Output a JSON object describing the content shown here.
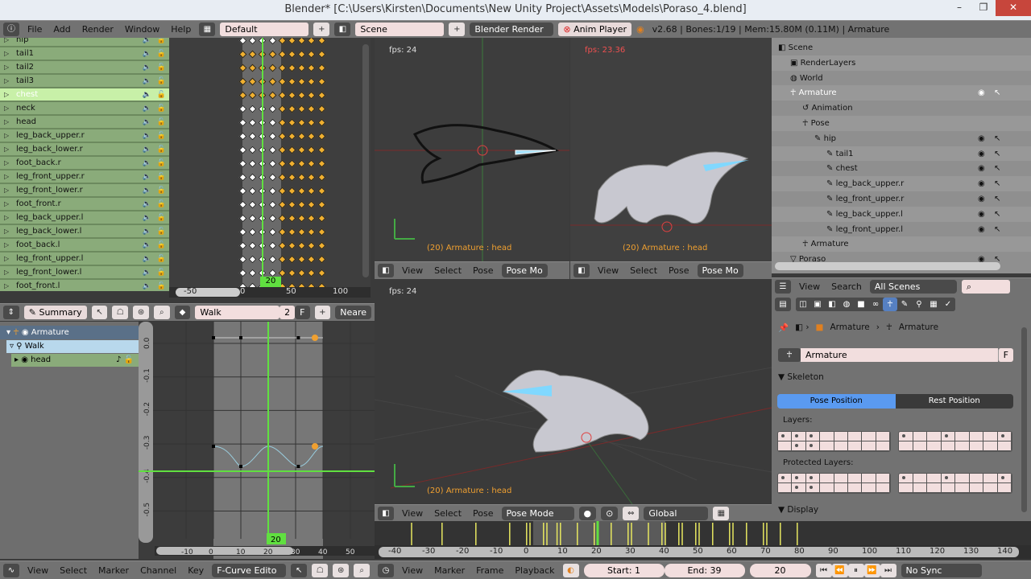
{
  "window": {
    "title": "Blender* [C:\\Users\\Kirsten\\Documents\\New Unity Project\\Assets\\Models\\Poraso_4.blend]",
    "min": "–",
    "max": "❐",
    "close": "✕"
  },
  "info_header": {
    "menus": [
      "File",
      "Add",
      "Render",
      "Window",
      "Help"
    ],
    "layout": "Default",
    "scene": "Scene",
    "engine": "Blender Render",
    "anim_player": "Anim Player",
    "stats": "v2.68 | Bones:1/19 | Mem:15.80M (0.11M) | Armature"
  },
  "dopesheet": {
    "channels": [
      "hip",
      "tail1",
      "tail2",
      "tail3",
      "chest",
      "neck",
      "head",
      "leg_back_upper.r",
      "leg_back_lower.r",
      "foot_back.r",
      "leg_front_upper.r",
      "leg_front_lower.r",
      "foot_front.r",
      "leg_back_upper.l",
      "leg_back_lower.l",
      "foot_back.l",
      "leg_front_upper.l",
      "leg_front_lower.l",
      "foot_front.l"
    ],
    "selected_channel": 4,
    "keyframes": [
      0,
      10,
      20,
      30,
      40,
      50,
      60,
      70,
      80
    ],
    "ruler": [
      "-50",
      "0",
      "50",
      "100"
    ],
    "current_frame": "20",
    "header": {
      "mode": "Summary",
      "action": "Walk",
      "users": "2",
      "fake": "F",
      "snap": "Neare"
    }
  },
  "graph": {
    "channels": [
      {
        "label": "Armature"
      },
      {
        "label": "Walk"
      },
      {
        "label": "head"
      }
    ],
    "y_ticks": [
      "0.0",
      "-0.1",
      "-0.2",
      "-0.3",
      "-0.4",
      "-0.5"
    ],
    "x_ticks": [
      "-10",
      "0",
      "10",
      "20",
      "30",
      "40",
      "50"
    ],
    "current_frame": "20",
    "header": {
      "menus": [
        "View",
        "Select",
        "Marker",
        "Channel",
        "Key"
      ],
      "mode": "F-Curve Edito"
    }
  },
  "viewports": {
    "top_left": {
      "fps": "fps: 24",
      "label": "(20) Armature : head"
    },
    "top_right": {
      "fps": "fps: 23.36",
      "label": "(20) Armature : head"
    },
    "bottom": {
      "fps": "fps: 24",
      "label": "(20) Armature : head"
    },
    "header": {
      "menus": [
        "View",
        "Select",
        "Pose"
      ],
      "mode": "Pose Mode",
      "mode_short": "Pose Mo",
      "orientation": "Global"
    }
  },
  "outliner": {
    "rows": [
      {
        "label": "Scene",
        "indent": 0
      },
      {
        "label": "RenderLayers",
        "indent": 1
      },
      {
        "label": "World",
        "indent": 1
      },
      {
        "label": "Armature",
        "indent": 1,
        "sel": true
      },
      {
        "label": "Animation",
        "indent": 2
      },
      {
        "label": "Pose",
        "indent": 2
      },
      {
        "label": "hip",
        "indent": 3
      },
      {
        "label": "tail1",
        "indent": 4
      },
      {
        "label": "chest",
        "indent": 4
      },
      {
        "label": "leg_back_upper.r",
        "indent": 4
      },
      {
        "label": "leg_front_upper.r",
        "indent": 4
      },
      {
        "label": "leg_back_upper.l",
        "indent": 4
      },
      {
        "label": "leg_front_upper.l",
        "indent": 4
      },
      {
        "label": "Armature",
        "indent": 2
      },
      {
        "label": "Poraso",
        "indent": 1
      }
    ],
    "header": {
      "menus": [
        "View",
        "Search"
      ],
      "filter": "All Scenes"
    }
  },
  "properties": {
    "breadcrumb": [
      "Armature",
      "Armature"
    ],
    "datablock": "Armature",
    "fake": "F",
    "skeleton": {
      "title": "Skeleton",
      "pose": "Pose Position",
      "rest": "Rest Position",
      "active": "Pose Position"
    },
    "layers_label": "Layers:",
    "protected_label": "Protected Layers:",
    "layers_a": [
      0,
      1,
      2,
      9,
      10
    ],
    "layers_b": [
      0,
      3,
      7
    ],
    "display": "Display"
  },
  "timeline": {
    "ticks": [
      "-40",
      "-30",
      "-20",
      "-10",
      "0",
      "10",
      "20",
      "30",
      "40",
      "50",
      "60",
      "70",
      "80",
      "90",
      "100",
      "110",
      "120",
      "130",
      "140"
    ],
    "keyframes": [
      -35,
      -26,
      -16,
      -6,
      -1,
      0,
      4,
      5,
      8,
      9,
      14,
      19,
      20,
      24,
      29,
      30,
      35,
      39,
      40,
      44,
      45,
      49,
      50,
      54,
      59,
      60,
      64,
      69,
      70,
      74,
      79
    ],
    "current_frame": 20,
    "menus": [
      "View",
      "Marker",
      "Frame",
      "Playback"
    ],
    "start": "Start: 1",
    "end": "End: 39",
    "frame": "20",
    "sync": "No Sync"
  },
  "colors": {
    "accent": "#5680c2",
    "playhead": "#60e040",
    "channel": "#8aab7a",
    "key_sel": "#ffffff",
    "key": "#f0b030"
  }
}
